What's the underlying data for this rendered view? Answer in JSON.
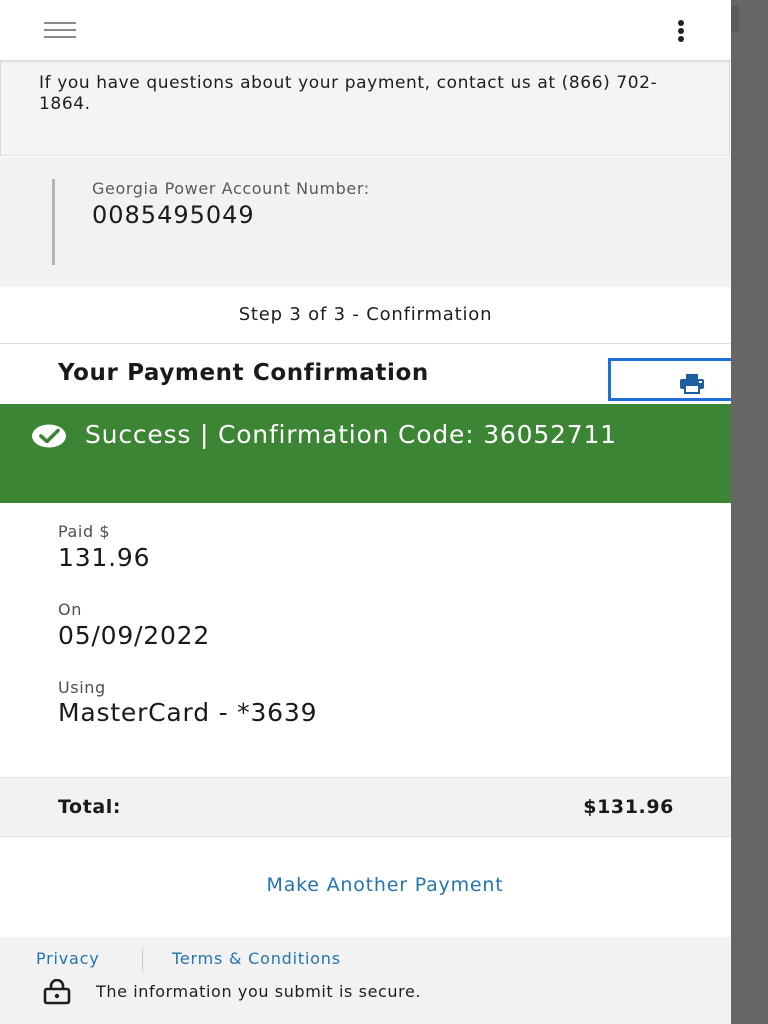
{
  "notice": {
    "text": "If you have questions about your payment, contact us at (866) 702-1864."
  },
  "account": {
    "label": "Georgia Power Account Number:",
    "number": "0085495049"
  },
  "step": {
    "text": "Step 3 of 3 - Confirmation"
  },
  "confirmation": {
    "title": "Your Payment Confirmation"
  },
  "success": {
    "text": "Success | Confirmation Code: 36052711"
  },
  "details": {
    "paid_label": "Paid $",
    "paid_value": "131.96",
    "on_label": "On",
    "on_value": "05/09/2022",
    "using_label": "Using",
    "using_value": "MasterCard - *3639"
  },
  "total": {
    "label": "Total:",
    "value": "$131.96"
  },
  "actions": {
    "another_payment": "Make Another Payment"
  },
  "footer": {
    "privacy": "Privacy",
    "terms": "Terms & Conditions",
    "secure": "The information you submit is secure."
  },
  "icons": {
    "menu": "hamburger-icon",
    "more": "kebab-icon",
    "print": "print-icon",
    "success": "check-circle-icon",
    "lock": "lock-icon"
  },
  "colors": {
    "success_green": "#3b8534",
    "link_blue": "#2474b0",
    "focus_blue": "#1f6fd6",
    "page_gray": "#f2f2f2"
  }
}
